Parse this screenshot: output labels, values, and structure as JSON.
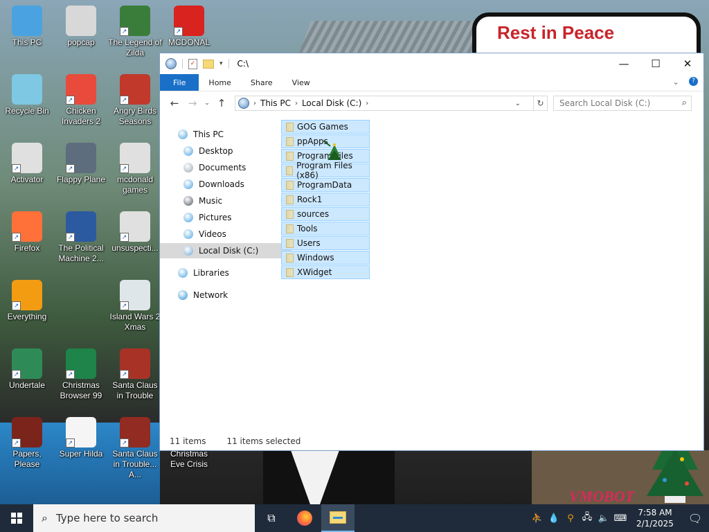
{
  "wallpaper": {
    "sign_text": "Rest in Peace",
    "watermark": "VMOBOT"
  },
  "desktop_icons": [
    {
      "label": "This PC",
      "color": "#4aa3e0"
    },
    {
      "label": "popcap",
      "color": "#d8d8d8"
    },
    {
      "label": "The Legend of Zilda",
      "color": "#3a7d3a"
    },
    {
      "label": "MCDONAL",
      "color": "#d8231f"
    },
    {
      "label": "Recycle Bin",
      "color": "#7ec8e3"
    },
    {
      "label": "Chicken Invaders 2",
      "color": "#e84b3c"
    },
    {
      "label": "Angry Birds Seasons",
      "color": "#c0392b"
    },
    {
      "label": "Activator",
      "color": "#e0e0e0"
    },
    {
      "label": "Flappy Plane",
      "color": "#5d6d7e"
    },
    {
      "label": "mcdonald games",
      "color": "#e0e0e0"
    },
    {
      "label": "Firefox",
      "color": "#ff7139"
    },
    {
      "label": "The Political Machine 2...",
      "color": "#2c5aa0"
    },
    {
      "label": "unsuspecti...",
      "color": "#e0e0e0"
    },
    {
      "label": "Everything",
      "color": "#f39c12"
    },
    {
      "label": "Island Wars 2 Xmas",
      "color": "#dfe6e9"
    },
    {
      "label": "Undertale",
      "color": "#2e8b57"
    },
    {
      "label": "Christmas Browser 99",
      "color": "#1e8449"
    },
    {
      "label": "Santa Claus in Trouble",
      "color": "#a93226"
    },
    {
      "label": "Papers, Please",
      "color": "#7b241c"
    },
    {
      "label": "Super Hilda",
      "color": "#f5f5f5"
    },
    {
      "label": "Santa Claus in Trouble... A...",
      "color": "#922b21"
    },
    {
      "label": "Christmas Eve Crisis",
      "color": "#34495e"
    }
  ],
  "explorer": {
    "title": "C:\\",
    "ribbon_tabs": [
      "File",
      "Home",
      "Share",
      "View"
    ],
    "breadcrumb": [
      "This PC",
      "Local Disk (C:)"
    ],
    "search_placeholder": "Search Local Disk (C:)",
    "nav": [
      {
        "label": "This PC",
        "color": "#4aa3e0"
      },
      {
        "label": "Desktop",
        "color": "#4aa3e0"
      },
      {
        "label": "Documents",
        "color": "#9aa6b2"
      },
      {
        "label": "Downloads",
        "color": "#4aa3e0"
      },
      {
        "label": "Music",
        "color": "#4a5560"
      },
      {
        "label": "Pictures",
        "color": "#4aa3e0"
      },
      {
        "label": "Videos",
        "color": "#4aa3e0"
      },
      {
        "label": "Local Disk (C:)",
        "color": "#6fa7d6"
      },
      {
        "label": "Libraries",
        "color": "#4aa3e0"
      },
      {
        "label": "Network",
        "color": "#2b8fd6"
      }
    ],
    "files": [
      "GOG Games",
      "ppApps",
      "Program Files",
      "Program Files (x86)",
      "ProgramData",
      "Rock1",
      "sources",
      "Tools",
      "Users",
      "Windows",
      "XWidget"
    ],
    "status_count": "11 items",
    "status_selected": "11 items selected"
  },
  "taskbar": {
    "search_placeholder": "Type here to search",
    "time": "7:58 AM",
    "date": "2/1/2025"
  },
  "colors": {
    "accent": "#1a6fc7",
    "selection": "#cce8ff",
    "taskbar": "#1f2b3a"
  }
}
